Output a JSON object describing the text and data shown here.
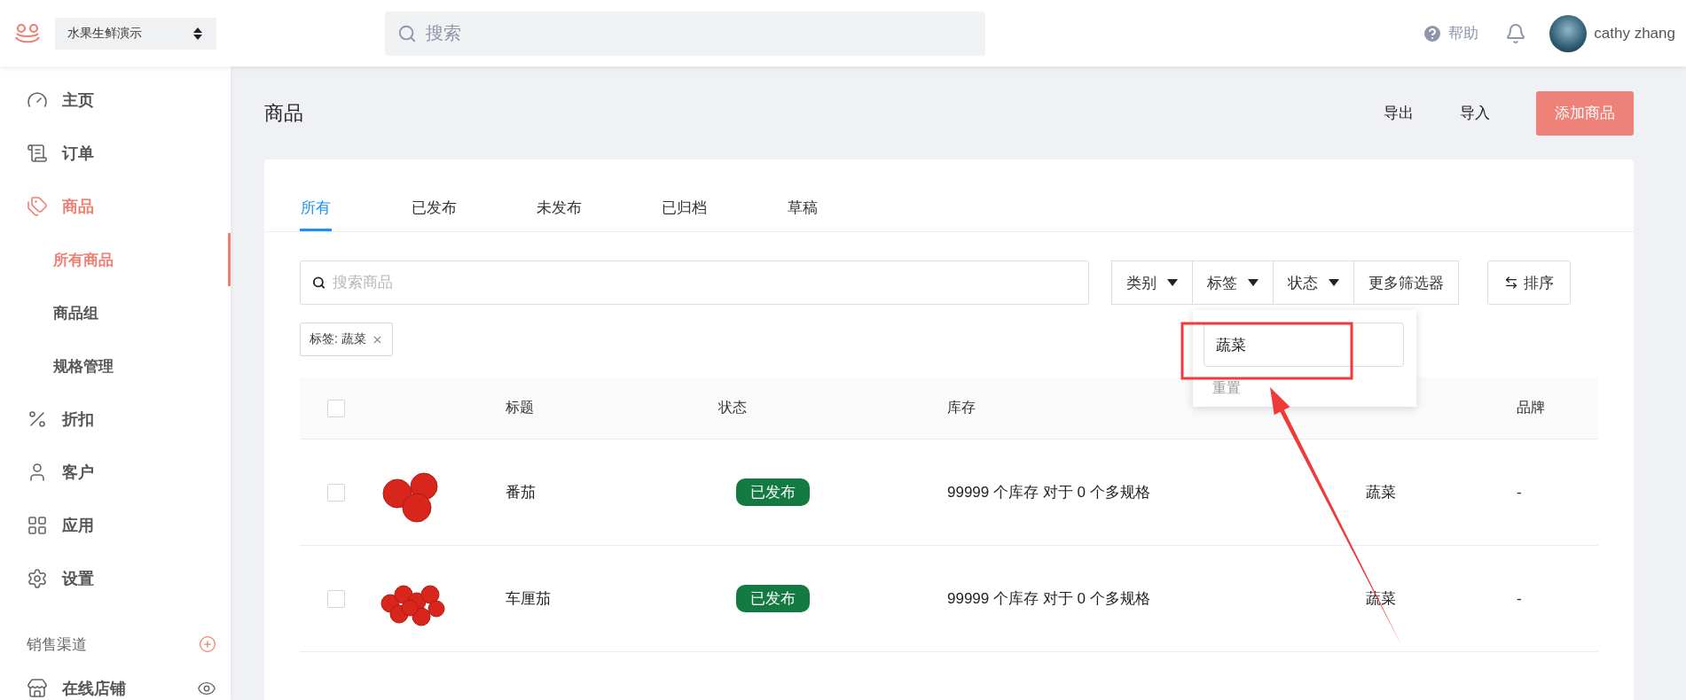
{
  "header": {
    "store": "水果生鲜演示",
    "search_placeholder": "搜索",
    "help": "帮助",
    "user": "cathy zhang"
  },
  "sidebar": {
    "items": [
      {
        "label": "主页",
        "selected": false
      },
      {
        "label": "订单",
        "selected": false
      },
      {
        "label": "商品",
        "selected": true,
        "expanded": true,
        "children": [
          {
            "label": "所有商品",
            "selected": true
          },
          {
            "label": "商品组",
            "selected": false
          },
          {
            "label": "规格管理",
            "selected": false
          }
        ]
      },
      {
        "label": "折扣",
        "selected": false
      },
      {
        "label": "客户",
        "selected": false
      },
      {
        "label": "应用",
        "selected": false
      },
      {
        "label": "设置",
        "selected": false
      }
    ],
    "section": {
      "title": "销售渠道",
      "items": [
        {
          "label": "在线店铺"
        }
      ]
    }
  },
  "page": {
    "title": "商品",
    "actions": [
      "导出",
      "导入"
    ],
    "primary_action": "添加商品"
  },
  "tabs": [
    {
      "label": "所有",
      "selected": true
    },
    {
      "label": "已发布",
      "selected": false
    },
    {
      "label": "未发布",
      "selected": false
    },
    {
      "label": "已归档",
      "selected": false
    },
    {
      "label": "草稿",
      "selected": false
    }
  ],
  "search": {
    "placeholder": "搜索商品"
  },
  "filters": [
    {
      "label": "类别",
      "dropdown": true,
      "open": false
    },
    {
      "label": "标签",
      "dropdown": true,
      "open": true
    },
    {
      "label": "状态",
      "dropdown": true,
      "open": false
    },
    {
      "label": "更多筛选器",
      "dropdown": false,
      "open": false
    }
  ],
  "sort": "排序",
  "tag_popover": {
    "value": "蔬菜",
    "reset": "重置"
  },
  "chips": [
    "标签: 蔬菜"
  ],
  "table": {
    "header_checked": false,
    "columns": [
      "标题",
      "状态",
      "库存",
      "品牌"
    ],
    "rows": [
      {
        "checked": false,
        "title": "番茄",
        "status": "已发布",
        "stock": "99999 个库存 对于 0 个多规格",
        "tag": "蔬菜",
        "brand": "-"
      },
      {
        "checked": false,
        "title": "车厘茄",
        "status": "已发布",
        "stock": "99999 个库存 对于 0 个多规格",
        "tag": "蔬菜",
        "brand": "-"
      }
    ]
  }
}
